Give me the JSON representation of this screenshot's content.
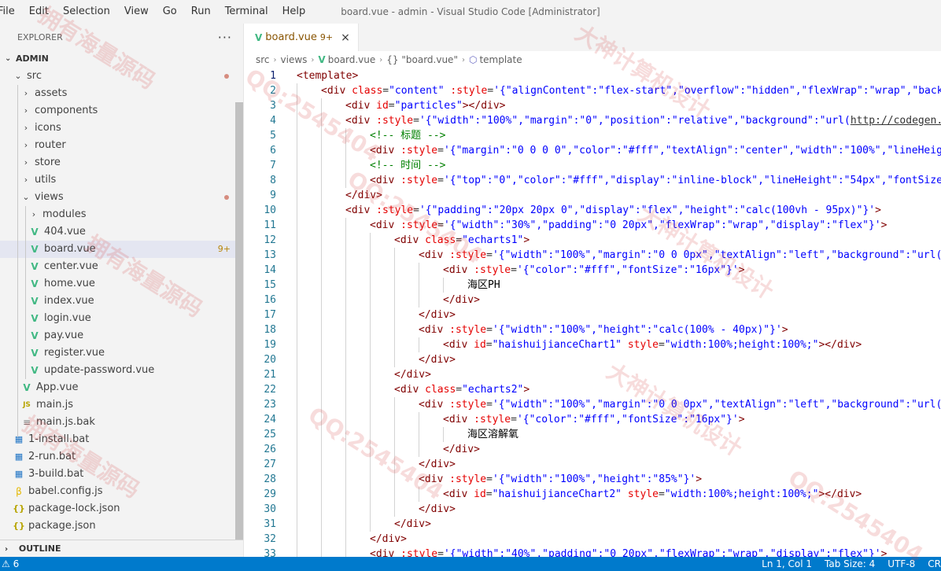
{
  "menu": [
    "File",
    "Edit",
    "Selection",
    "View",
    "Go",
    "Run",
    "Terminal",
    "Help"
  ],
  "window_title": "board.vue - admin - Visual Studio Code [Administrator]",
  "explorer": {
    "header": "EXPLORER",
    "more": "···",
    "root": "ADMIN",
    "outline": "OUTLINE",
    "items": [
      {
        "label": "src",
        "indent": 1,
        "type": "folder-open",
        "dot": true
      },
      {
        "label": "assets",
        "indent": 2,
        "type": "folder"
      },
      {
        "label": "components",
        "indent": 2,
        "type": "folder"
      },
      {
        "label": "icons",
        "indent": 2,
        "type": "folder"
      },
      {
        "label": "router",
        "indent": 2,
        "type": "folder"
      },
      {
        "label": "store",
        "indent": 2,
        "type": "folder"
      },
      {
        "label": "utils",
        "indent": 2,
        "type": "folder"
      },
      {
        "label": "views",
        "indent": 2,
        "type": "folder-open",
        "dot": true
      },
      {
        "label": "modules",
        "indent": 3,
        "type": "folder"
      },
      {
        "label": "404.vue",
        "indent": 3,
        "type": "vue"
      },
      {
        "label": "board.vue",
        "indent": 3,
        "type": "vue",
        "badge": "9+",
        "selected": true
      },
      {
        "label": "center.vue",
        "indent": 3,
        "type": "vue"
      },
      {
        "label": "home.vue",
        "indent": 3,
        "type": "vue"
      },
      {
        "label": "index.vue",
        "indent": 3,
        "type": "vue"
      },
      {
        "label": "login.vue",
        "indent": 3,
        "type": "vue"
      },
      {
        "label": "pay.vue",
        "indent": 3,
        "type": "vue"
      },
      {
        "label": "register.vue",
        "indent": 3,
        "type": "vue"
      },
      {
        "label": "update-password.vue",
        "indent": 3,
        "type": "vue"
      },
      {
        "label": "App.vue",
        "indent": 2,
        "type": "vue"
      },
      {
        "label": "main.js",
        "indent": 2,
        "type": "js"
      },
      {
        "label": "main.js.bak",
        "indent": 2,
        "type": "bak"
      },
      {
        "label": "1-install.bat",
        "indent": 1,
        "type": "bat"
      },
      {
        "label": "2-run.bat",
        "indent": 1,
        "type": "bat"
      },
      {
        "label": "3-build.bat",
        "indent": 1,
        "type": "bat"
      },
      {
        "label": "babel.config.js",
        "indent": 1,
        "type": "babel"
      },
      {
        "label": "package-lock.json",
        "indent": 1,
        "type": "json"
      },
      {
        "label": "package.json",
        "indent": 1,
        "type": "json"
      }
    ]
  },
  "tab": {
    "name": "board.vue",
    "badge": "9+",
    "close": "×"
  },
  "breadcrumb": [
    "src",
    "views",
    "board.vue",
    "{} \"board.vue\"",
    "template"
  ],
  "code_lines": [
    [
      0,
      [
        [
          "t",
          "<template>"
        ]
      ]
    ],
    [
      1,
      [
        [
          "t",
          "<div "
        ],
        [
          "a",
          "class"
        ],
        [
          "p",
          "="
        ],
        [
          "s",
          "\"content\""
        ],
        [
          "a",
          " :style"
        ],
        [
          "p",
          "="
        ],
        [
          "s",
          "'{\"alignContent\":\"flex-start\",\"overflow\":\"hidden\",\"flexWrap\":\"wrap\",\"backg"
        ]
      ]
    ],
    [
      2,
      [
        [
          "t",
          "<div "
        ],
        [
          "a",
          "id"
        ],
        [
          "p",
          "="
        ],
        [
          "s",
          "\"particles\""
        ],
        [
          "t",
          "></div>"
        ]
      ]
    ],
    [
      2,
      [
        [
          "t",
          "<div "
        ],
        [
          "a",
          ":style"
        ],
        [
          "p",
          "="
        ],
        [
          "s",
          "'{\"width\":\"100%\",\"margin\":\"0\",\"position\":\"relative\",\"background\":\"url("
        ],
        [
          "u",
          "http://codegen.c"
        ]
      ]
    ],
    [
      3,
      [
        [
          "c",
          "<!-- 标题 -->"
        ]
      ]
    ],
    [
      3,
      [
        [
          "t",
          "<div "
        ],
        [
          "a",
          ":style"
        ],
        [
          "p",
          "="
        ],
        [
          "s",
          "'{\"margin\":\"0 0 0 0\",\"color\":\"#fff\",\"textAlign\":\"center\",\"width\":\"100%\",\"lineHeigh"
        ]
      ]
    ],
    [
      3,
      [
        [
          "c",
          "<!-- 时间 -->"
        ]
      ]
    ],
    [
      3,
      [
        [
          "t",
          "<div "
        ],
        [
          "a",
          ":style"
        ],
        [
          "p",
          "="
        ],
        [
          "s",
          "'{\"top\":\"0\",\"color\":\"#fff\",\"display\":\"inline-block\",\"lineHeight\":\"54px\",\"fontSize\""
        ]
      ]
    ],
    [
      2,
      [
        [
          "t",
          "</div>"
        ]
      ]
    ],
    [
      2,
      [
        [
          "t",
          "<div "
        ],
        [
          "a",
          ":style"
        ],
        [
          "p",
          "="
        ],
        [
          "s",
          "'{\"padding\":\"20px 20px 0\",\"display\":\"flex\",\"height\":\"calc(100vh - 95px)\"}'"
        ],
        [
          "t",
          ">"
        ]
      ]
    ],
    [
      3,
      [
        [
          "t",
          "<div "
        ],
        [
          "a",
          ":style"
        ],
        [
          "p",
          "="
        ],
        [
          "s",
          "'{\"width\":\"30%\",\"padding\":\"0 20px\",\"flexWrap\":\"wrap\",\"display\":\"flex\"}'"
        ],
        [
          "t",
          ">"
        ]
      ]
    ],
    [
      4,
      [
        [
          "t",
          "<div "
        ],
        [
          "a",
          "class"
        ],
        [
          "p",
          "="
        ],
        [
          "s",
          "\"echarts1\""
        ],
        [
          "t",
          ">"
        ]
      ]
    ],
    [
      5,
      [
        [
          "t",
          "<div "
        ],
        [
          "a",
          ":style"
        ],
        [
          "p",
          "="
        ],
        [
          "s",
          "'{\"width\":\"100%\",\"margin\":\"0 0 0px\",\"textAlign\":\"left\",\"background\":\"url(h"
        ]
      ]
    ],
    [
      6,
      [
        [
          "t",
          "<div "
        ],
        [
          "a",
          ":style"
        ],
        [
          "p",
          "="
        ],
        [
          "s",
          "'{\"color\":\"#fff\",\"fontSize\":\"16px\"}'"
        ],
        [
          "t",
          ">"
        ]
      ]
    ],
    [
      7,
      [
        [
          "x",
          "海区PH"
        ]
      ]
    ],
    [
      6,
      [
        [
          "t",
          "</div>"
        ]
      ]
    ],
    [
      5,
      [
        [
          "t",
          "</div>"
        ]
      ]
    ],
    [
      5,
      [
        [
          "t",
          "<div "
        ],
        [
          "a",
          ":style"
        ],
        [
          "p",
          "="
        ],
        [
          "s",
          "'{\"width\":\"100%\",\"height\":\"calc(100% - 40px)\"}'"
        ],
        [
          "t",
          ">"
        ]
      ]
    ],
    [
      6,
      [
        [
          "t",
          "<div "
        ],
        [
          "a",
          "id"
        ],
        [
          "p",
          "="
        ],
        [
          "s",
          "\"haishuijianceChart1\""
        ],
        [
          "a",
          " style"
        ],
        [
          "p",
          "="
        ],
        [
          "s",
          "\"width:100%;height:100%;\""
        ],
        [
          "t",
          "></div>"
        ]
      ]
    ],
    [
      5,
      [
        [
          "t",
          "</div>"
        ]
      ]
    ],
    [
      4,
      [
        [
          "t",
          "</div>"
        ]
      ]
    ],
    [
      4,
      [
        [
          "t",
          "<div "
        ],
        [
          "a",
          "class"
        ],
        [
          "p",
          "="
        ],
        [
          "s",
          "\"echarts2\""
        ],
        [
          "t",
          ">"
        ]
      ]
    ],
    [
      5,
      [
        [
          "t",
          "<div "
        ],
        [
          "a",
          ":style"
        ],
        [
          "p",
          "="
        ],
        [
          "s",
          "'{\"width\":\"100%\",\"margin\":\"0 0 0px\",\"textAlign\":\"left\",\"background\":\"url(h"
        ]
      ]
    ],
    [
      6,
      [
        [
          "t",
          "<div "
        ],
        [
          "a",
          ":style"
        ],
        [
          "p",
          "="
        ],
        [
          "s",
          "'{\"color\":\"#fff\",\"fontSize\":\"16px\"}'"
        ],
        [
          "t",
          ">"
        ]
      ]
    ],
    [
      7,
      [
        [
          "x",
          "海区溶解氧"
        ]
      ]
    ],
    [
      6,
      [
        [
          "t",
          "</div>"
        ]
      ]
    ],
    [
      5,
      [
        [
          "t",
          "</div>"
        ]
      ]
    ],
    [
      5,
      [
        [
          "t",
          "<div "
        ],
        [
          "a",
          ":style"
        ],
        [
          "p",
          "="
        ],
        [
          "s",
          "'{\"width\":\"100%\",\"height\":\"85%\"}'"
        ],
        [
          "t",
          ">"
        ]
      ]
    ],
    [
      6,
      [
        [
          "t",
          "<div "
        ],
        [
          "a",
          "id"
        ],
        [
          "p",
          "="
        ],
        [
          "s",
          "\"haishuijianceChart2\""
        ],
        [
          "a",
          " style"
        ],
        [
          "p",
          "="
        ],
        [
          "s",
          "\"width:100%;height:100%;\""
        ],
        [
          "t",
          "></div>"
        ]
      ]
    ],
    [
      5,
      [
        [
          "t",
          "</div>"
        ]
      ]
    ],
    [
      4,
      [
        [
          "t",
          "</div>"
        ]
      ]
    ],
    [
      3,
      [
        [
          "t",
          "</div>"
        ]
      ]
    ],
    [
      3,
      [
        [
          "t",
          "<div "
        ],
        [
          "a",
          ":style"
        ],
        [
          "p",
          "="
        ],
        [
          "s",
          "'{\"width\":\"40%\",\"padding\":\"0 20px\",\"flexWrap\":\"wrap\",\"display\":\"flex\"}'"
        ],
        [
          "t",
          ">"
        ]
      ]
    ]
  ],
  "status": {
    "problems": "⚠ 6",
    "position": "Ln 1, Col 1",
    "tab_size": "Tab Size: 4",
    "encoding": "UTF-8",
    "eol": "CR"
  },
  "watermark_texts": [
    "拥有海量源码",
    "QQ:2545404",
    "大神计算机设计",
    "拥有海量源码",
    "QQ:2545404",
    "大神计算机设计",
    "拥有海量源码",
    "QQ:2545404",
    "大神计算机设计",
    "QQ:2545404"
  ],
  "colors": {
    "statusbar": "#007acc",
    "vue": "#41b883",
    "tag": "#800000",
    "attr": "#e50000",
    "string": "#0000ff",
    "comment": "#008000",
    "linenum": "#237893"
  }
}
